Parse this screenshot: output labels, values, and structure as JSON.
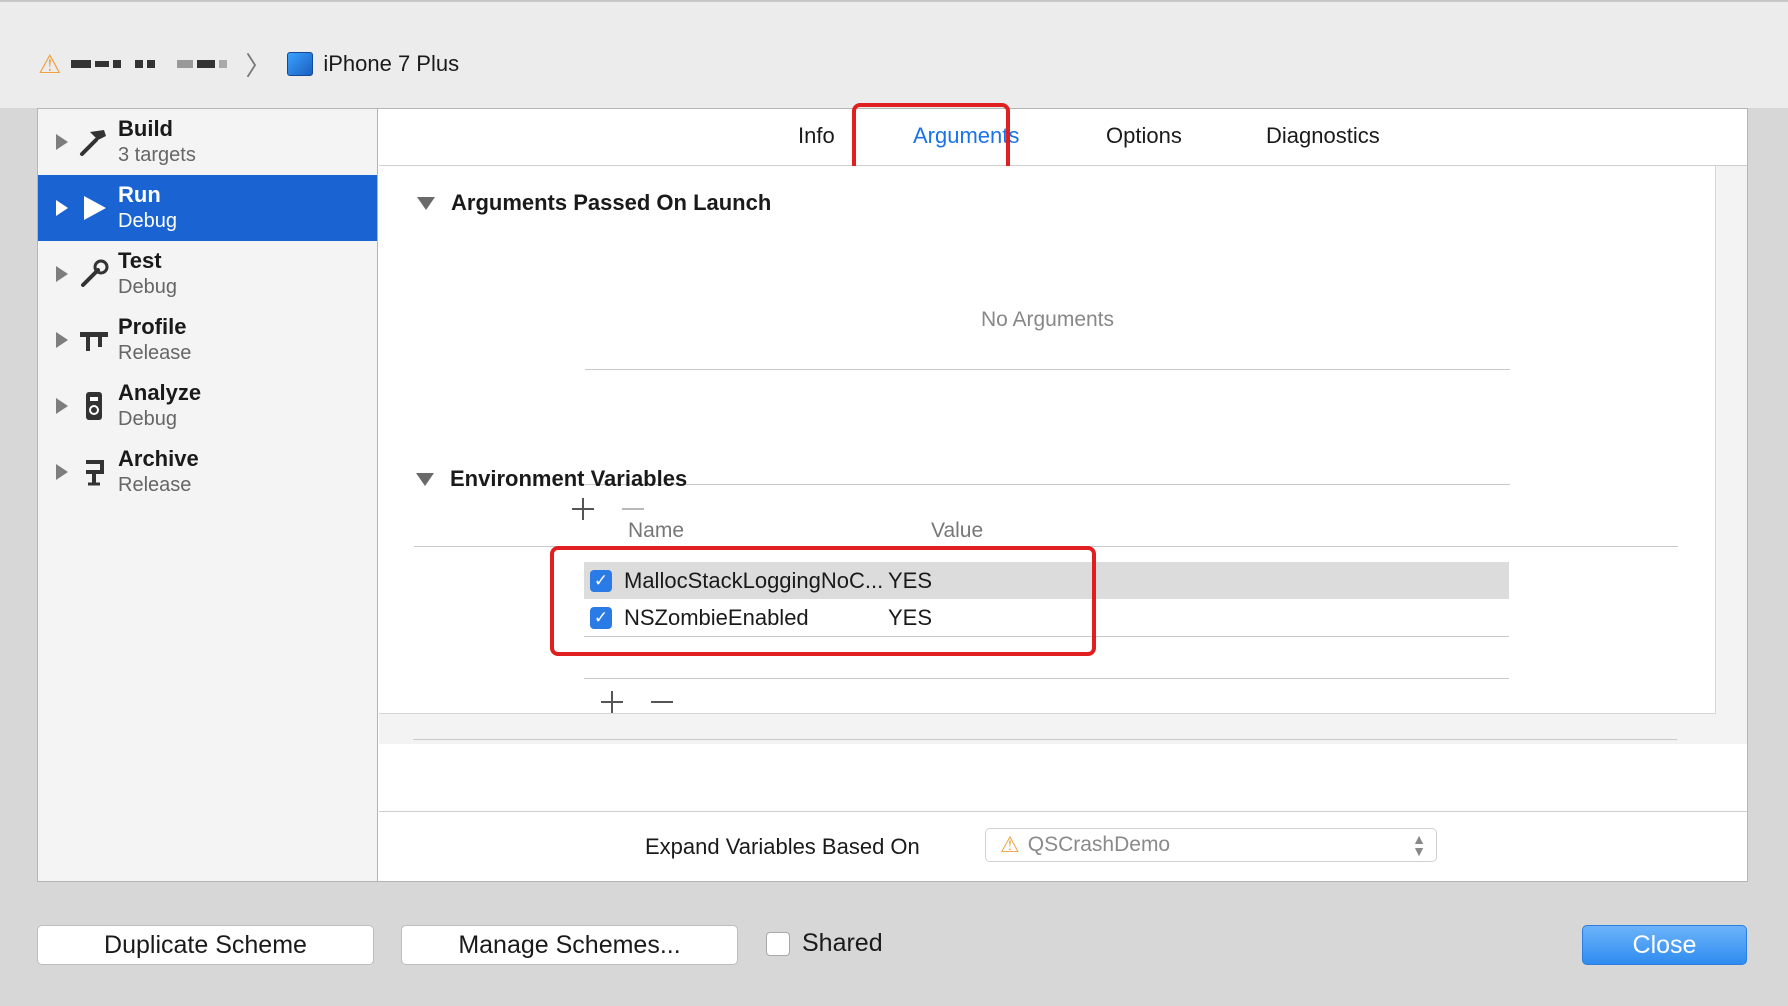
{
  "breadcrumb": {
    "device": "iPhone 7 Plus"
  },
  "sidebar": {
    "items": [
      {
        "title": "Build",
        "subtitle": "3 targets",
        "icon": "hammer-icon",
        "selected": false
      },
      {
        "title": "Run",
        "subtitle": "Debug",
        "icon": "play-icon",
        "selected": true
      },
      {
        "title": "Test",
        "subtitle": "Debug",
        "icon": "wrench-icon",
        "selected": false
      },
      {
        "title": "Profile",
        "subtitle": "Release",
        "icon": "caliper-icon",
        "selected": false
      },
      {
        "title": "Analyze",
        "subtitle": "Debug",
        "icon": "analyze-icon",
        "selected": false
      },
      {
        "title": "Archive",
        "subtitle": "Release",
        "icon": "archive-icon",
        "selected": false
      }
    ]
  },
  "tabs": [
    "Info",
    "Arguments",
    "Options",
    "Diagnostics"
  ],
  "active_tab": "Arguments",
  "arguments_section": {
    "title": "Arguments Passed On Launch",
    "empty_text": "No Arguments"
  },
  "env_section": {
    "title": "Environment Variables",
    "col_name": "Name",
    "col_value": "Value",
    "rows": [
      {
        "name": "MallocStackLoggingNoC...",
        "value": "YES",
        "checked": true
      },
      {
        "name": "NSZombieEnabled",
        "value": "YES",
        "checked": true
      }
    ]
  },
  "expand": {
    "label": "Expand Variables Based On",
    "value": "QSCrashDemo"
  },
  "footer": {
    "duplicate_label": "Duplicate Scheme",
    "manage_label": "Manage Schemes...",
    "shared_label": "Shared",
    "close_label": "Close"
  },
  "colors": {
    "selection": "#1963d2",
    "accent": "#1a73e8",
    "highlight": "#e02020"
  }
}
